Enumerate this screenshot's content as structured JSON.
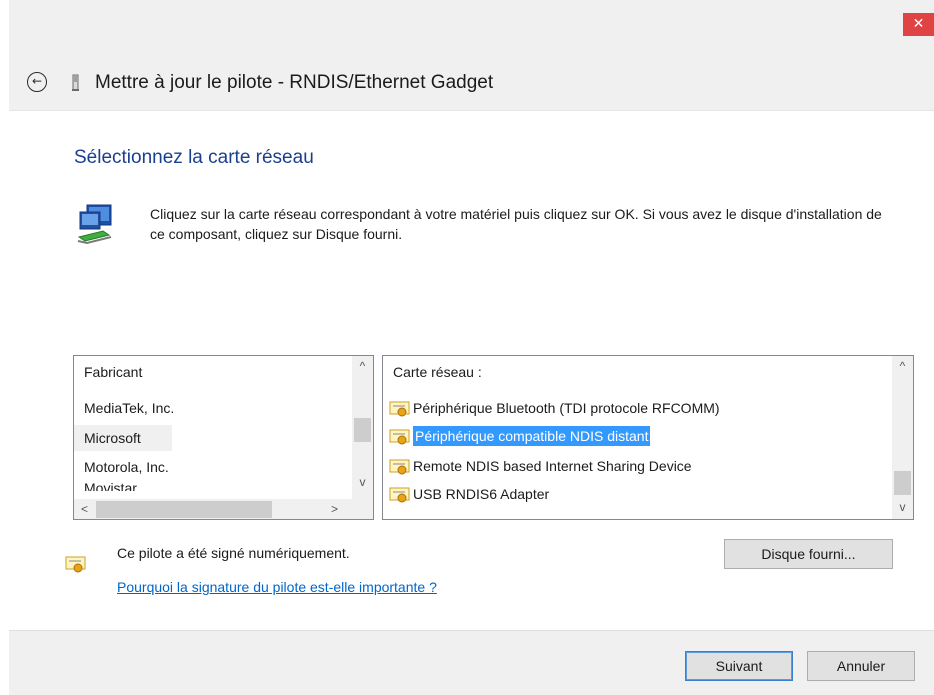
{
  "window": {
    "title": "Mettre à jour le pilote - RNDIS/Ethernet Gadget",
    "close_glyph": "✕",
    "back_glyph": "←"
  },
  "page": {
    "heading": "Sélectionnez la carte réseau",
    "instructions": "Cliquez sur la carte réseau correspondant à votre matériel puis cliquez sur OK. Si vous avez le disque d'installation de ce composant, cliquez sur Disque fourni."
  },
  "manufacturer_list": {
    "header": "Fabricant",
    "items": [
      "MediaTek, Inc.",
      "Microsoft",
      "Motorola, Inc.",
      "Movistar"
    ],
    "selected": "Microsoft"
  },
  "adapter_list": {
    "header": "Carte réseau :",
    "items": [
      "Périphérique Bluetooth (TDI protocole RFCOMM)",
      "Périphérique compatible NDIS distant",
      "Remote NDIS based Internet Sharing Device",
      "USB RNDIS6 Adapter"
    ],
    "selected": "Périphérique compatible NDIS distant"
  },
  "signature": {
    "text": "Ce pilote a été signé numériquement.",
    "link": "Pourquoi la signature du pilote est-elle importante ?"
  },
  "buttons": {
    "have_disk": "Disque fourni...",
    "next": "Suivant",
    "cancel": "Annuler"
  },
  "scroll_glyphs": {
    "up": "^",
    "down": "v",
    "left": "<",
    "right": ">"
  },
  "colors": {
    "accent_blue": "#3399ff",
    "heading_blue": "#1b3f8f",
    "link_blue": "#0066cc",
    "close_red": "#e04343"
  },
  "icons": [
    "back-arrow-icon",
    "driver-device-icon",
    "network-adapter-icon",
    "certificate-icon"
  ]
}
